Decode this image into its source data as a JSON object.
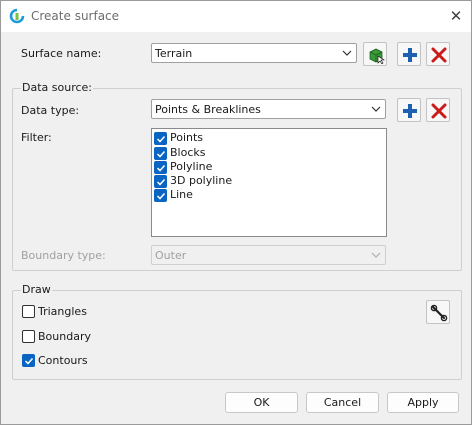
{
  "window": {
    "title": "Create surface",
    "close_icon": "close-icon"
  },
  "surface": {
    "label": "Surface name:",
    "value": "Terrain"
  },
  "data_source": {
    "group_label": "Data source:",
    "data_type_label": "Data type:",
    "data_type_value": "Points & Breaklines",
    "filter_label": "Filter:",
    "filter_items": [
      {
        "label": "Points",
        "checked": true
      },
      {
        "label": "Blocks",
        "checked": true
      },
      {
        "label": "Polyline",
        "checked": true
      },
      {
        "label": "3D polyline",
        "checked": true
      },
      {
        "label": "Line",
        "checked": true
      }
    ],
    "boundary_label": "Boundary type:",
    "boundary_value": "Outer"
  },
  "draw": {
    "group_label": "Draw",
    "items": [
      {
        "label": "Triangles",
        "checked": false
      },
      {
        "label": "Boundary",
        "checked": false
      },
      {
        "label": "Contours",
        "checked": true
      }
    ],
    "settings_icon": "wrench-icon"
  },
  "buttons": {
    "ok": "OK",
    "cancel": "Cancel",
    "apply": "Apply"
  },
  "colors": {
    "accent": "#0a64c2",
    "add": "#1f5fb0",
    "delete": "#cc1a1a",
    "surface_icon": "#3a9a3a"
  }
}
